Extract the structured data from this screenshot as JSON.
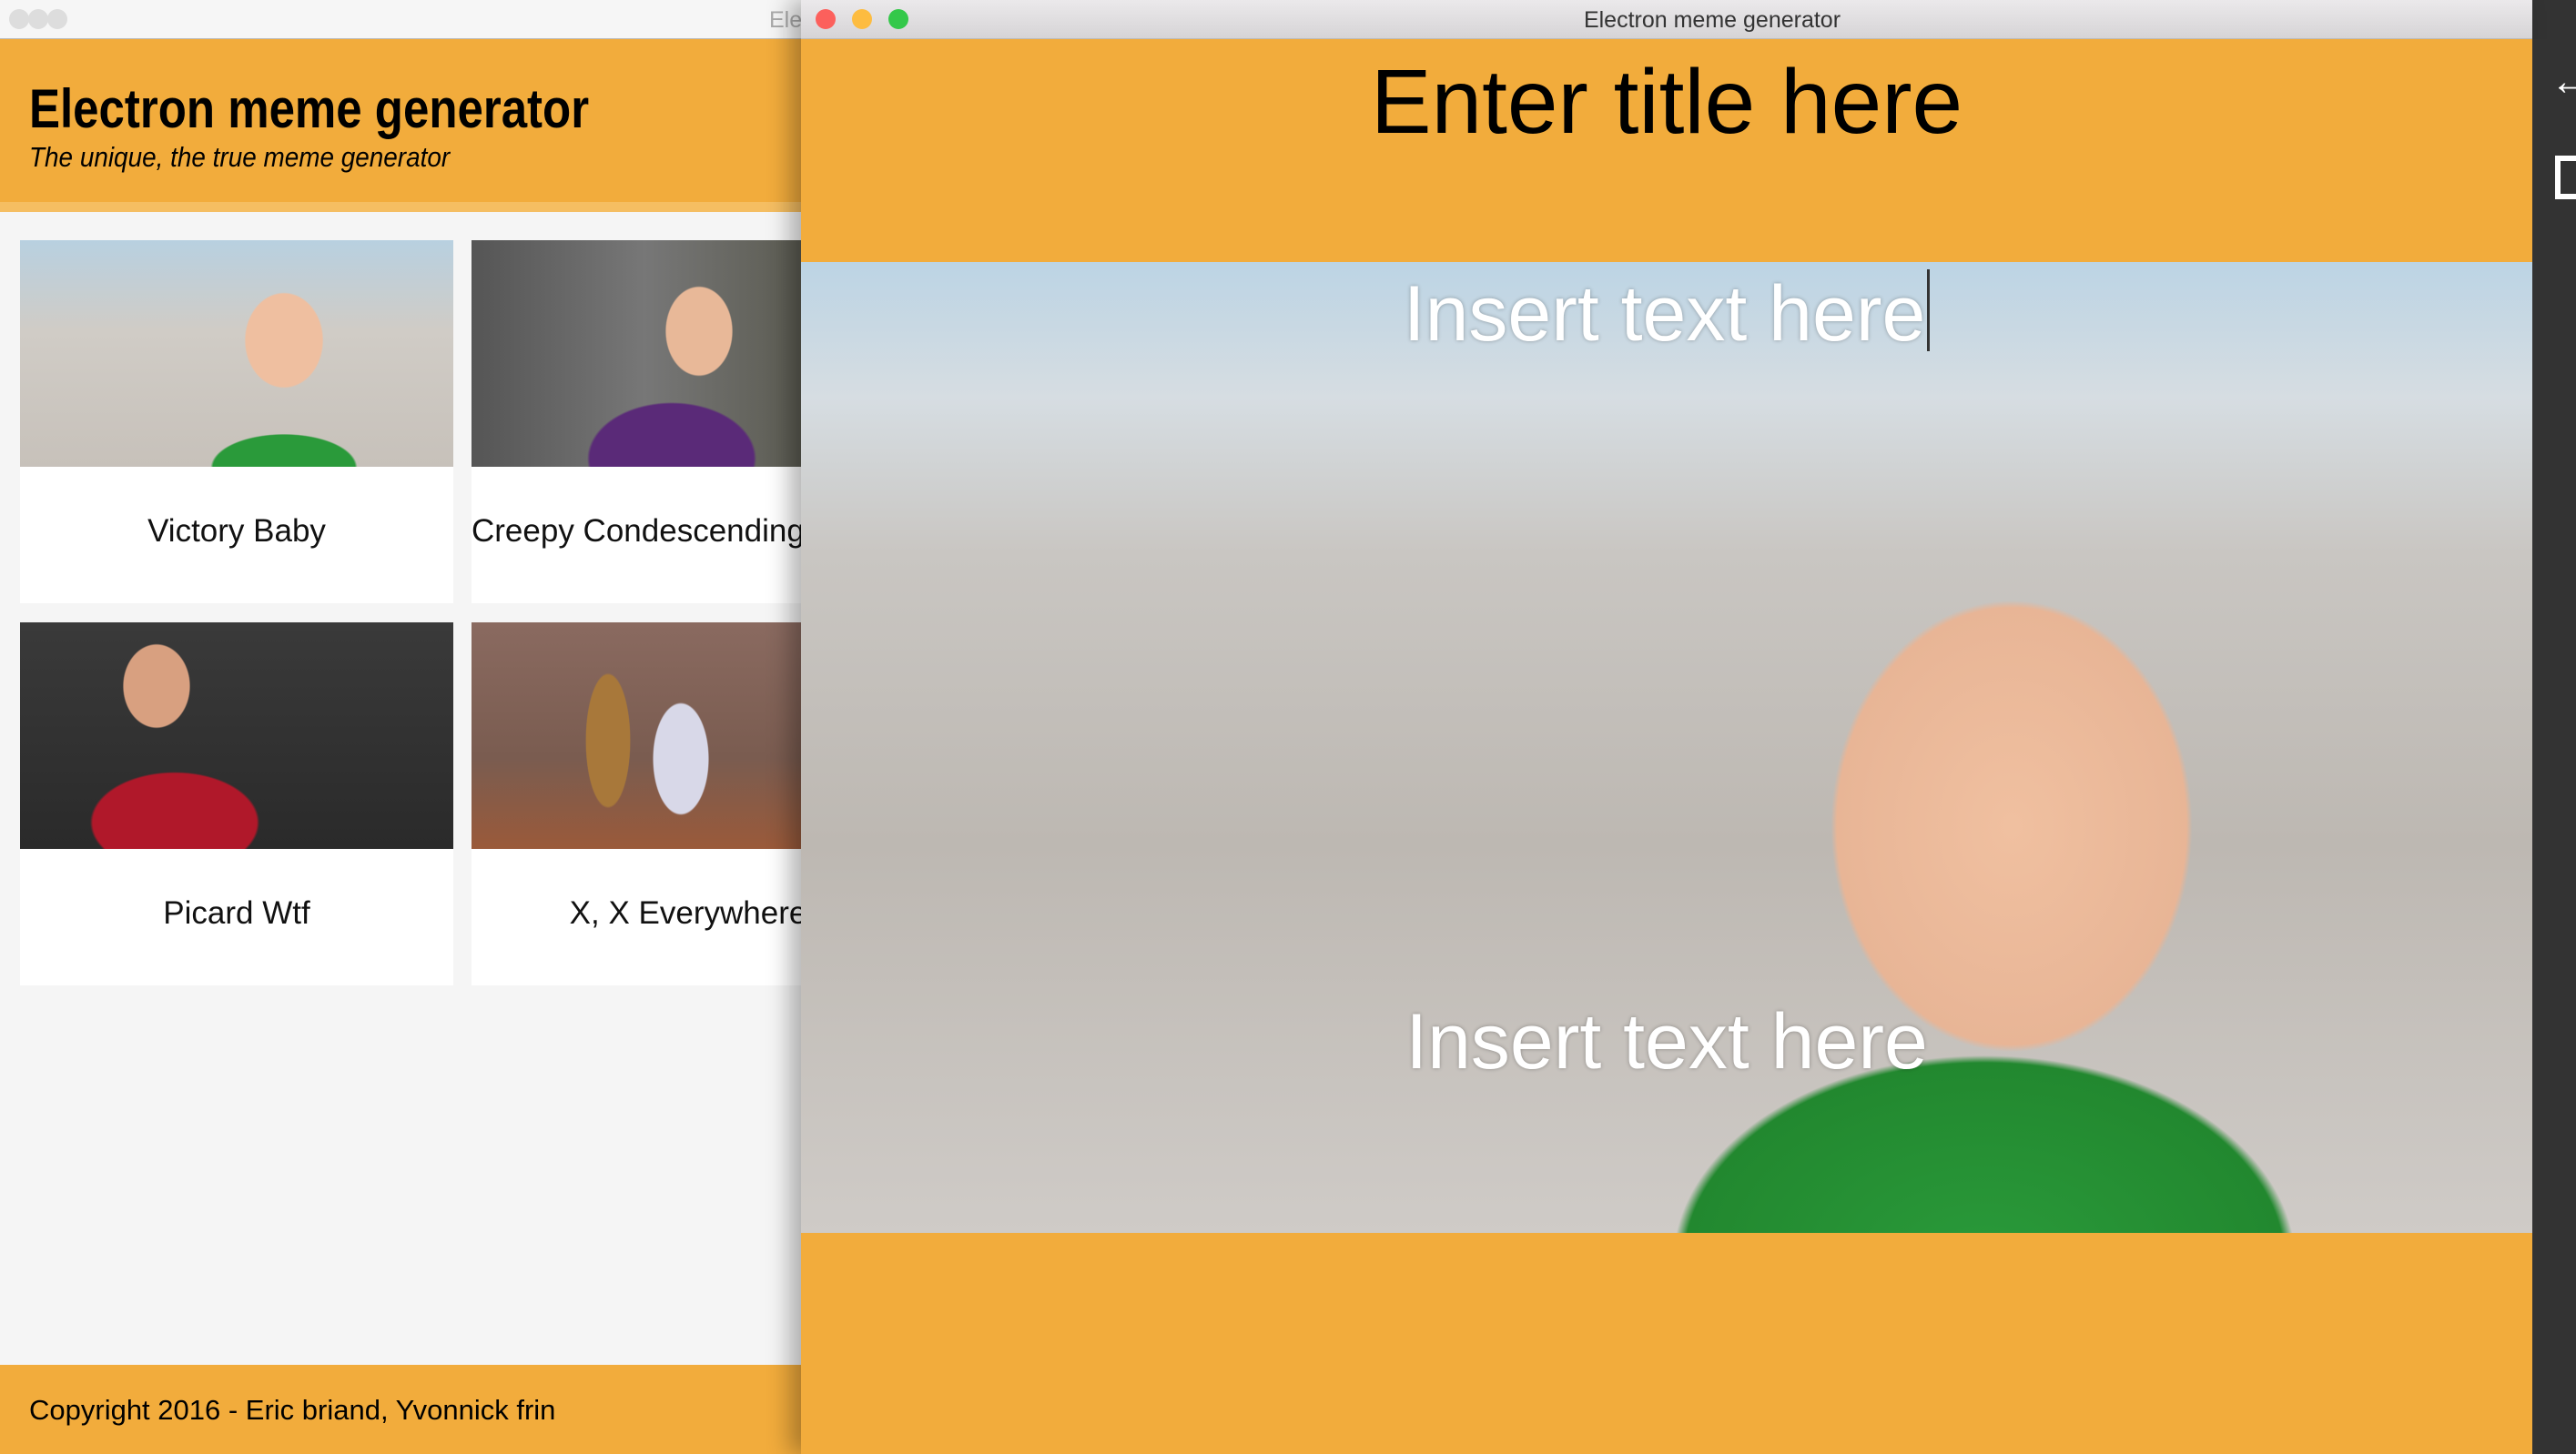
{
  "left_window": {
    "title": "Electron meme generator",
    "title_visible": "Ele",
    "header": {
      "title": "Electron meme generator",
      "subtitle": "The unique, the true meme generator"
    },
    "memes": [
      {
        "label": "Victory Baby"
      },
      {
        "label": "Creepy Condescending Wonka"
      },
      {
        "label": "Picard Wtf"
      },
      {
        "label": "X, X Everywhere"
      }
    ],
    "footer": "Copyright 2016 - Eric briand, Yvonnick frin"
  },
  "right_window": {
    "title": "Electron meme generator",
    "meme_title": "Enter title here",
    "top_text": "Insert text here",
    "bottom_text": "Insert text here"
  },
  "colors": {
    "accent": "#F2AC3C",
    "close": "#FC605C",
    "minimize": "#FDBC40",
    "zoom": "#34C84A"
  },
  "side_panel": {
    "icons": [
      "arrow-left-icon",
      "layout-icon"
    ]
  }
}
